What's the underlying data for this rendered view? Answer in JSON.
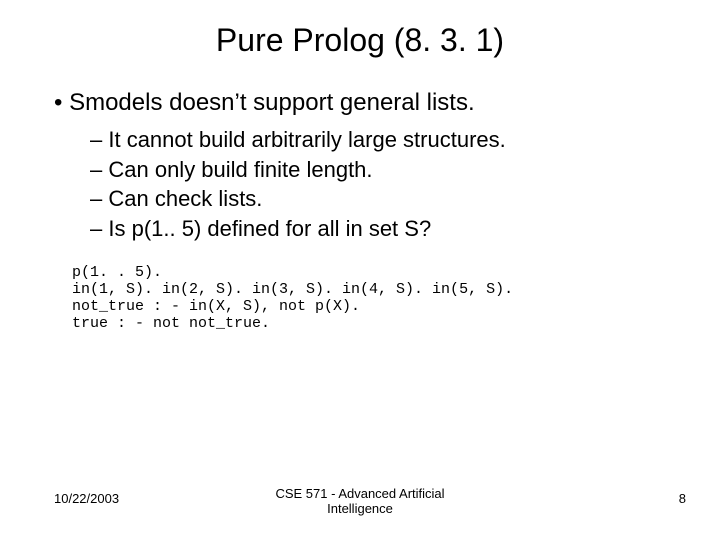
{
  "title": "Pure Prolog (8. 3. 1)",
  "bullets": {
    "main": "Smodels doesn’t support general lists.",
    "subs": [
      "It cannot build arbitrarily large structures.",
      "Can only build finite length.",
      "Can check lists.",
      "Is p(1.. 5) defined for all in set S?"
    ]
  },
  "code": "p(1. . 5).\nin(1, S). in(2, S). in(3, S). in(4, S). in(5, S).\nnot_true : - in(X, S), not p(X).\ntrue : - not not_true.",
  "footer": {
    "date": "10/22/2003",
    "course": "CSE 571 - Advanced Artificial\nIntelligence",
    "page": "8"
  }
}
